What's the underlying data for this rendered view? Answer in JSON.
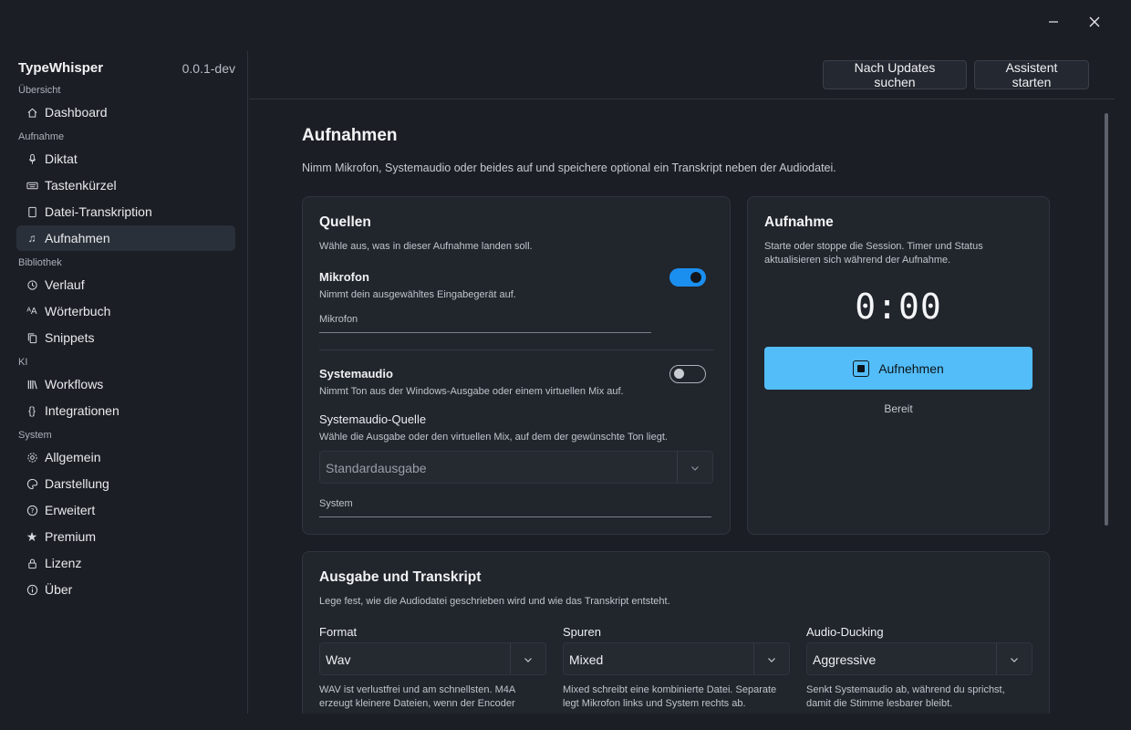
{
  "window": {
    "minimize_label": "—",
    "close_label": "✕"
  },
  "app": {
    "name": "TypeWhisper",
    "version": "0.0.1-dev"
  },
  "sidebar": {
    "sections": [
      {
        "label": "Übersicht"
      },
      {
        "label": "Aufnahme"
      },
      {
        "label": "Bibliothek"
      },
      {
        "label": "KI"
      },
      {
        "label": "System"
      }
    ],
    "items": [
      {
        "label": "Dashboard",
        "icon": "home-icon"
      },
      {
        "label": "Diktat",
        "icon": "microphone-icon"
      },
      {
        "label": "Tastenkürzel",
        "icon": "keyboard-icon"
      },
      {
        "label": "Datei-Transkription",
        "icon": "file-icon"
      },
      {
        "label": "Aufnahmen",
        "icon": "music-icon",
        "active": true
      },
      {
        "label": "Verlauf",
        "icon": "history-icon"
      },
      {
        "label": "Wörterbuch",
        "icon": "dictionary-icon"
      },
      {
        "label": "Snippets",
        "icon": "copy-icon"
      },
      {
        "label": "Workflows",
        "icon": "library-icon"
      },
      {
        "label": "Integrationen",
        "icon": "braces-icon"
      },
      {
        "label": "Allgemein",
        "icon": "gear-icon"
      },
      {
        "label": "Darstellung",
        "icon": "palette-icon"
      },
      {
        "label": "Erweitert",
        "icon": "help-icon"
      },
      {
        "label": "Premium",
        "icon": "star-icon"
      },
      {
        "label": "Lizenz",
        "icon": "lock-icon"
      },
      {
        "label": "Über",
        "icon": "info-icon"
      }
    ]
  },
  "toolbar": {
    "updates_label": "Nach Updates suchen",
    "assistant_label": "Assistent starten"
  },
  "page": {
    "title": "Aufnahmen",
    "subtitle": "Nimm Mikrofon, Systemaudio oder beides auf und speichere optional ein Transkript neben der Audiodatei."
  },
  "sources": {
    "title": "Quellen",
    "subtitle": "Wähle aus, was in dieser Aufnahme landen soll.",
    "mic": {
      "title": "Mikrofon",
      "desc": "Nimmt dein ausgewähltes Eingabegerät auf.",
      "field_label": "Mikrofon",
      "enabled": true
    },
    "system": {
      "title": "Systemaudio",
      "desc": "Nimmt Ton aus der Windows-Ausgabe oder einem virtuellen Mix auf.",
      "enabled": false,
      "source_title": "Systemaudio-Quelle",
      "source_desc": "Wähle die Ausgabe oder den virtuellen Mix, auf dem der gewünschte Ton liegt.",
      "source_value": "Standardausgabe",
      "field_label": "System"
    }
  },
  "recording": {
    "title": "Aufnahme",
    "subtitle": "Starte oder stoppe die Session. Timer und Status aktualisieren sich während der Aufnahme.",
    "timer": "0:00",
    "button_label": "Aufnehmen",
    "status": "Bereit",
    "accent": "#53bdf9"
  },
  "output": {
    "title": "Ausgabe und Transkript",
    "subtitle": "Lege fest, wie die Audiodatei geschrieben wird und wie das Transkript entsteht.",
    "format": {
      "label": "Format",
      "value": "Wav",
      "desc": "WAV ist verlustfrei und am schnellsten. M4A erzeugt kleinere Dateien, wenn der Encoder"
    },
    "tracks": {
      "label": "Spuren",
      "value": "Mixed",
      "desc": "Mixed schreibt eine kombinierte Datei. Separate legt Mikrofon links und System rechts ab."
    },
    "ducking": {
      "label": "Audio-Ducking",
      "value": "Aggressive",
      "desc": "Senkt Systemaudio ab, während du sprichst, damit die Stimme lesbarer bleibt."
    }
  }
}
